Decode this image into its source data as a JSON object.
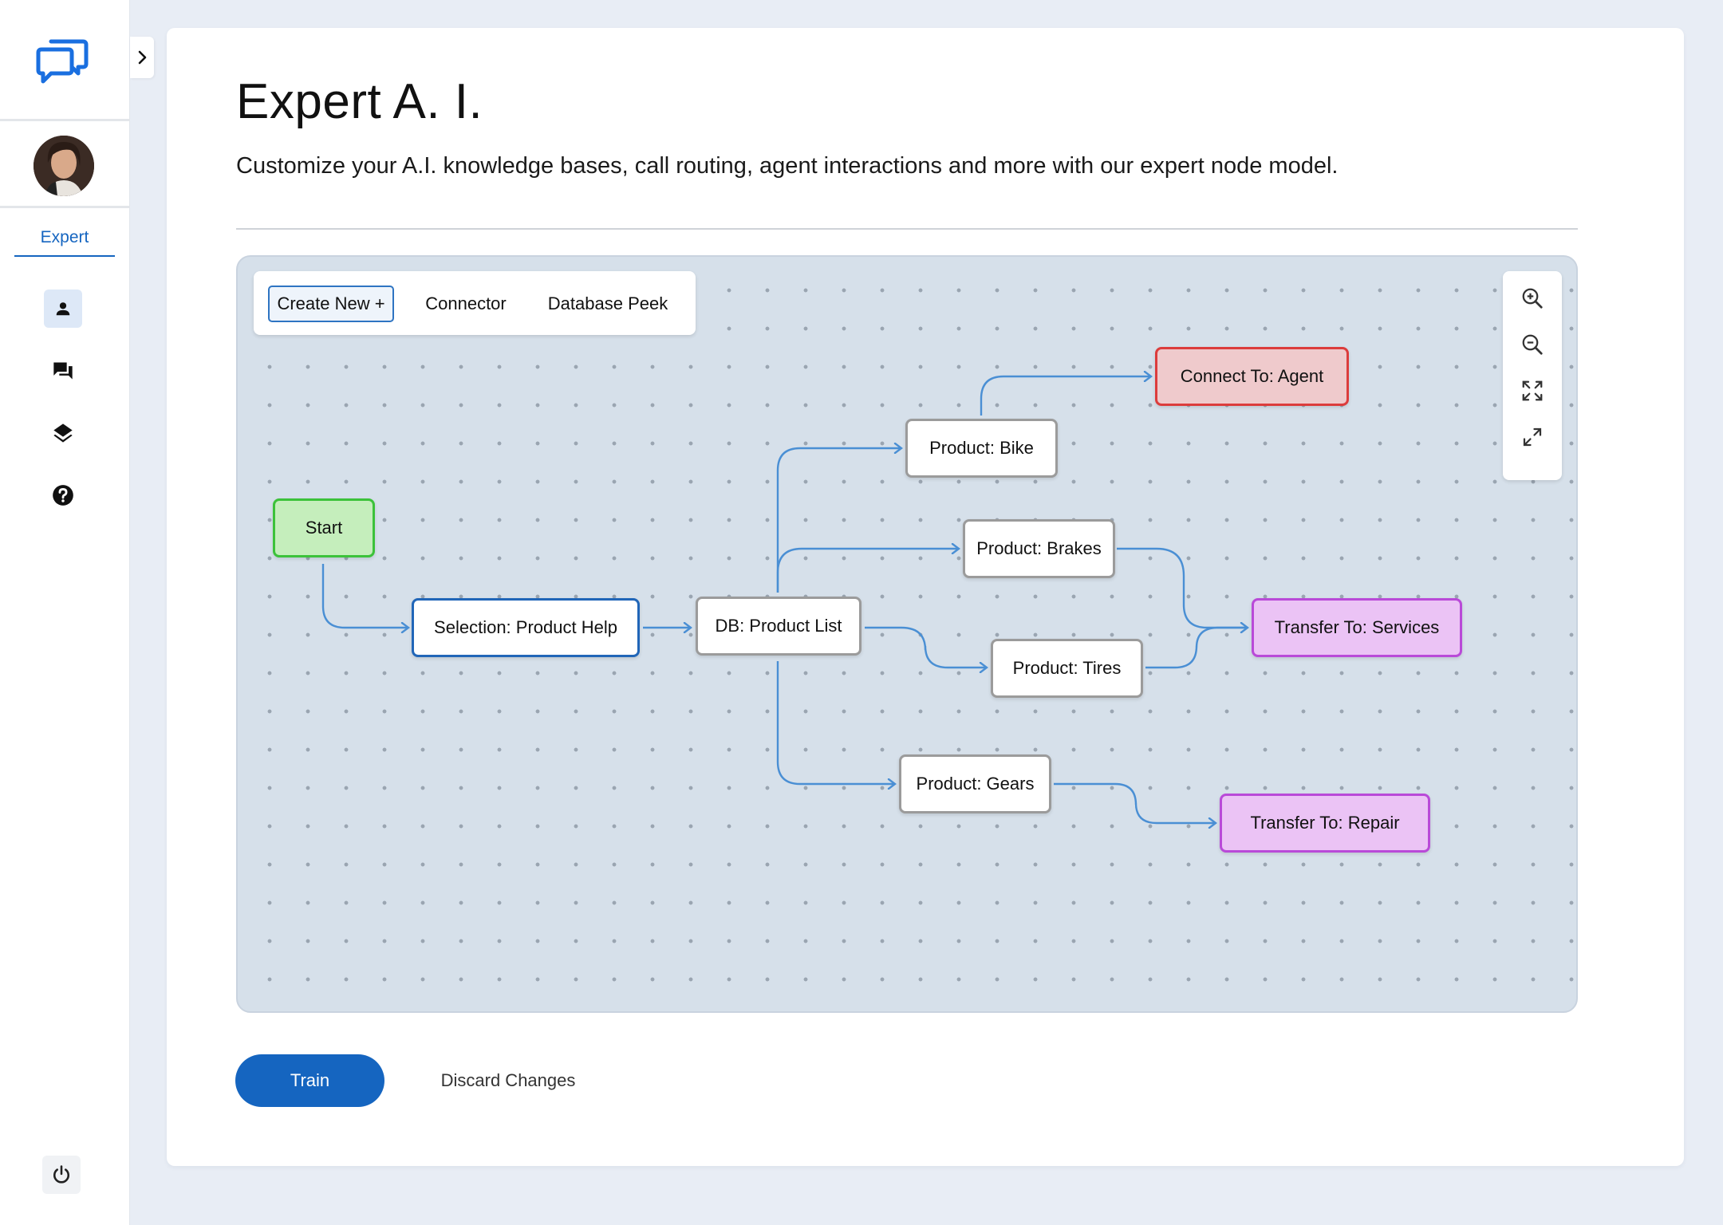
{
  "sidebar": {
    "active_section": "Expert",
    "nav_items": [
      {
        "icon": "person-icon",
        "active": true
      },
      {
        "icon": "chat-icon",
        "active": false
      },
      {
        "icon": "layers-icon",
        "active": false
      },
      {
        "icon": "help-icon",
        "active": false
      }
    ],
    "bottom_icon": "power-icon",
    "accent_color": "#1565c0"
  },
  "header": {
    "title": "Expert A. I.",
    "subtitle": "Customize your A.I. knowledge bases, call routing, agent interactions and more with our expert node model."
  },
  "toolbar": {
    "create_label": "Create New +",
    "connector_label": "Connector",
    "database_label": "Database Peek"
  },
  "zoom_controls": [
    "zoom-in-icon",
    "zoom-out-icon",
    "expand-icon",
    "collapse-icon"
  ],
  "flow": {
    "nodes": {
      "start": "Start",
      "selection": "Selection: Product Help",
      "db": "DB: Product List",
      "bike": "Product: Bike",
      "brakes": "Product: Brakes",
      "tires": "Product: Tires",
      "gears": "Product: Gears",
      "agent": "Connect To: Agent",
      "services": "Transfer To: Services",
      "repair": "Transfer To: Repair"
    },
    "edges": [
      [
        "start",
        "selection"
      ],
      [
        "selection",
        "db"
      ],
      [
        "db",
        "bike"
      ],
      [
        "db",
        "brakes"
      ],
      [
        "db",
        "tires"
      ],
      [
        "db",
        "gears"
      ],
      [
        "bike",
        "agent"
      ],
      [
        "brakes",
        "services"
      ],
      [
        "tires",
        "services"
      ],
      [
        "gears",
        "repair"
      ]
    ],
    "colors": {
      "edge": "#4a8fd4",
      "start": "#c5eebc",
      "agent": "#efcacc",
      "transfer": "#ebc3f5"
    }
  },
  "actions": {
    "train_label": "Train",
    "discard_label": "Discard Changes"
  }
}
